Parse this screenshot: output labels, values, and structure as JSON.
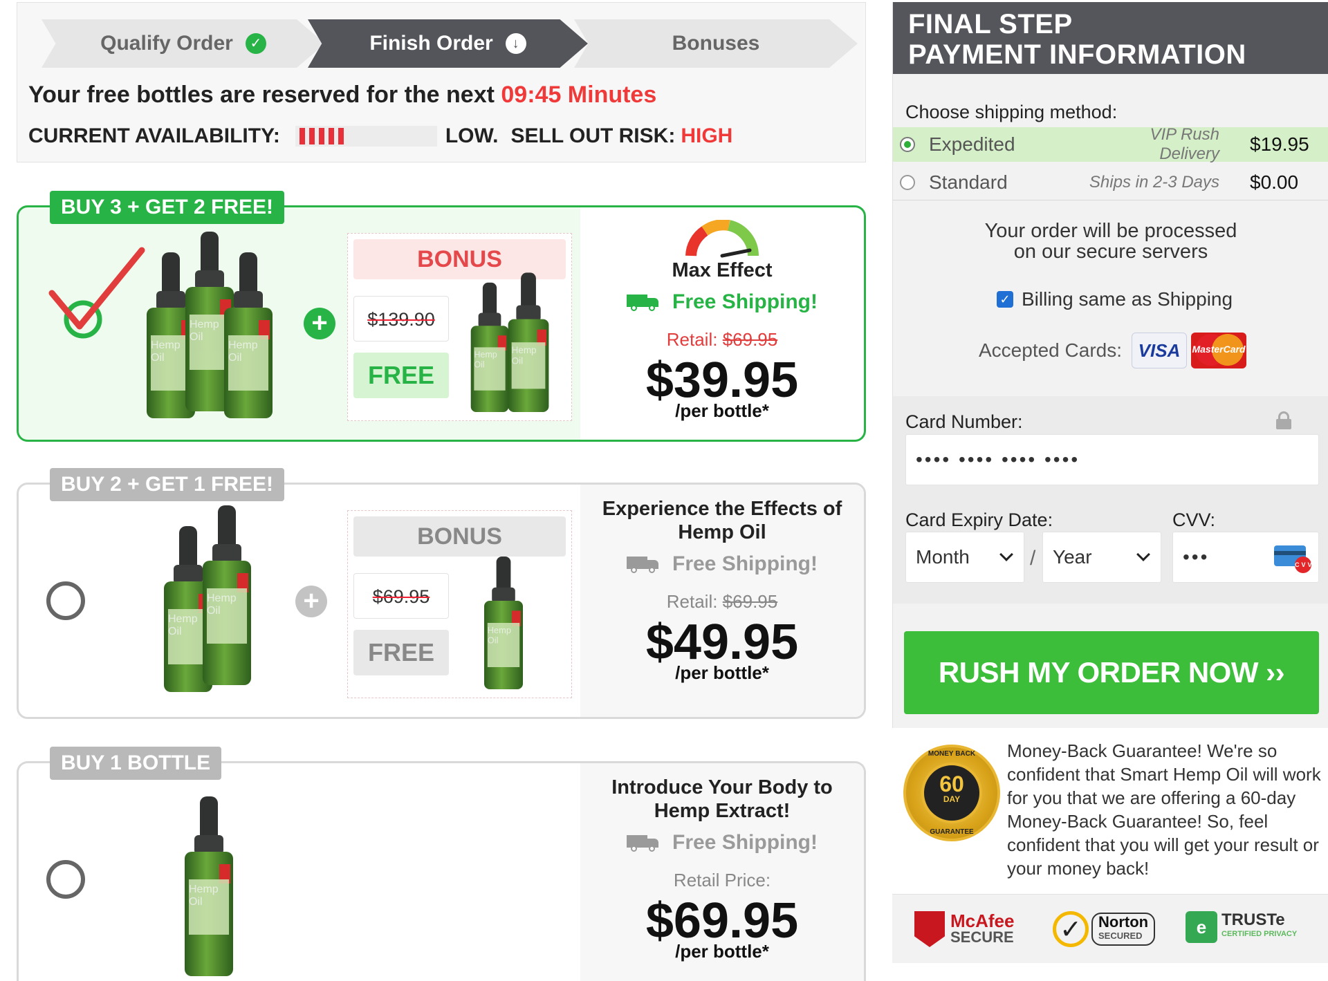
{
  "steps": [
    {
      "label": "Qualify Order",
      "icon": "check-circle-icon"
    },
    {
      "label": "Finish Order",
      "icon": "download-circle-icon"
    },
    {
      "label": "Bonuses"
    }
  ],
  "timer": {
    "text": "Your free bottles are reserved for the next",
    "time": "09:45 Minutes"
  },
  "availability": {
    "label": "CURRENT AVAILABILITY:",
    "level": "LOW.",
    "risk_label": "SELL OUT RISK:",
    "risk_value": "HIGH",
    "bar_fill_fraction": 0.32
  },
  "packages": [
    {
      "tag": "BUY 3 + GET 2 FREE!",
      "selected": true,
      "bottles": 3,
      "bonus_label": "BONUS",
      "bonus_old_price": "$139.90",
      "bonus_free": "FREE",
      "bonus_bottles": 2,
      "headline": "Max Effect",
      "shipping": "Free Shipping!",
      "retail_label": "Retail:",
      "retail_price": "$69.95",
      "price": "$39.95",
      "per": "/per bottle*"
    },
    {
      "tag": "BUY 2 + GET 1 FREE!",
      "selected": false,
      "bottles": 2,
      "bonus_label": "BONUS",
      "bonus_old_price": "$69.95",
      "bonus_free": "FREE",
      "bonus_bottles": 1,
      "headline": "Experience the Effects of Hemp Oil",
      "shipping": "Free Shipping!",
      "retail_label": "Retail:",
      "retail_price": "$69.95",
      "price": "$49.95",
      "per": "/per bottle*"
    },
    {
      "tag": "BUY 1 BOTTLE",
      "selected": false,
      "bottles": 1,
      "headline": "Introduce Your Body to Hemp Extract!",
      "shipping": "Free Shipping!",
      "retail_label": "Retail Price:",
      "price": "$69.95",
      "per": "/per bottle*"
    }
  ],
  "bottle_label": "Hemp Oil",
  "payment": {
    "header_line1": "FINAL STEP",
    "header_line2": "PAYMENT INFORMATION",
    "shipping_label": "Choose shipping method:",
    "shipping_options": [
      {
        "name": "Expedited",
        "desc": "VIP Rush Delivery",
        "price": "$19.95",
        "selected": true
      },
      {
        "name": "Standard",
        "desc": "Ships in 2-3 Days",
        "price": "$0.00",
        "selected": false
      }
    ],
    "secure_line1": "Your order will be processed",
    "secure_line2": "on our secure servers",
    "billing_same": "Billing same as Shipping",
    "billing_checked": true,
    "accepted_cards": "Accepted Cards:",
    "visa": "VISA",
    "mastercard": "MasterCard",
    "card_number_label": "Card Number:",
    "card_number_placeholder": "•••• •••• •••• ••••",
    "expiry_label": "Card Expiry Date:",
    "month": "Month",
    "separator": "/",
    "year": "Year",
    "cvv_label": "CVV:",
    "cvv_placeholder": "•••",
    "cvv_badge": "CVV",
    "submit": "RUSH MY ORDER NOW ››"
  },
  "guarantee": {
    "seal_top": "MONEY BACK",
    "seal_number": "60",
    "seal_day": "DAY",
    "seal_bottom": "GUARANTEE",
    "text": "Money-Back Guarantee! We're so confident that Smart Hemp Oil will work for you that we are offering a 60-day Money-Back Guarantee! So, feel confident that you will get your result or your money back!"
  },
  "trust": {
    "mcafee_line1": "McAfee",
    "mcafee_line2": "SECURE",
    "norton_line1": "Norton",
    "norton_line2": "SECURED",
    "truste_line1": "TRUSTe",
    "truste_line2": "CERTIFIED PRIVACY"
  },
  "colors": {
    "accent_green": "#27b345",
    "alert_red": "#f03a3a",
    "header_grey": "#55565b",
    "submit_green": "#3cbe3a"
  }
}
